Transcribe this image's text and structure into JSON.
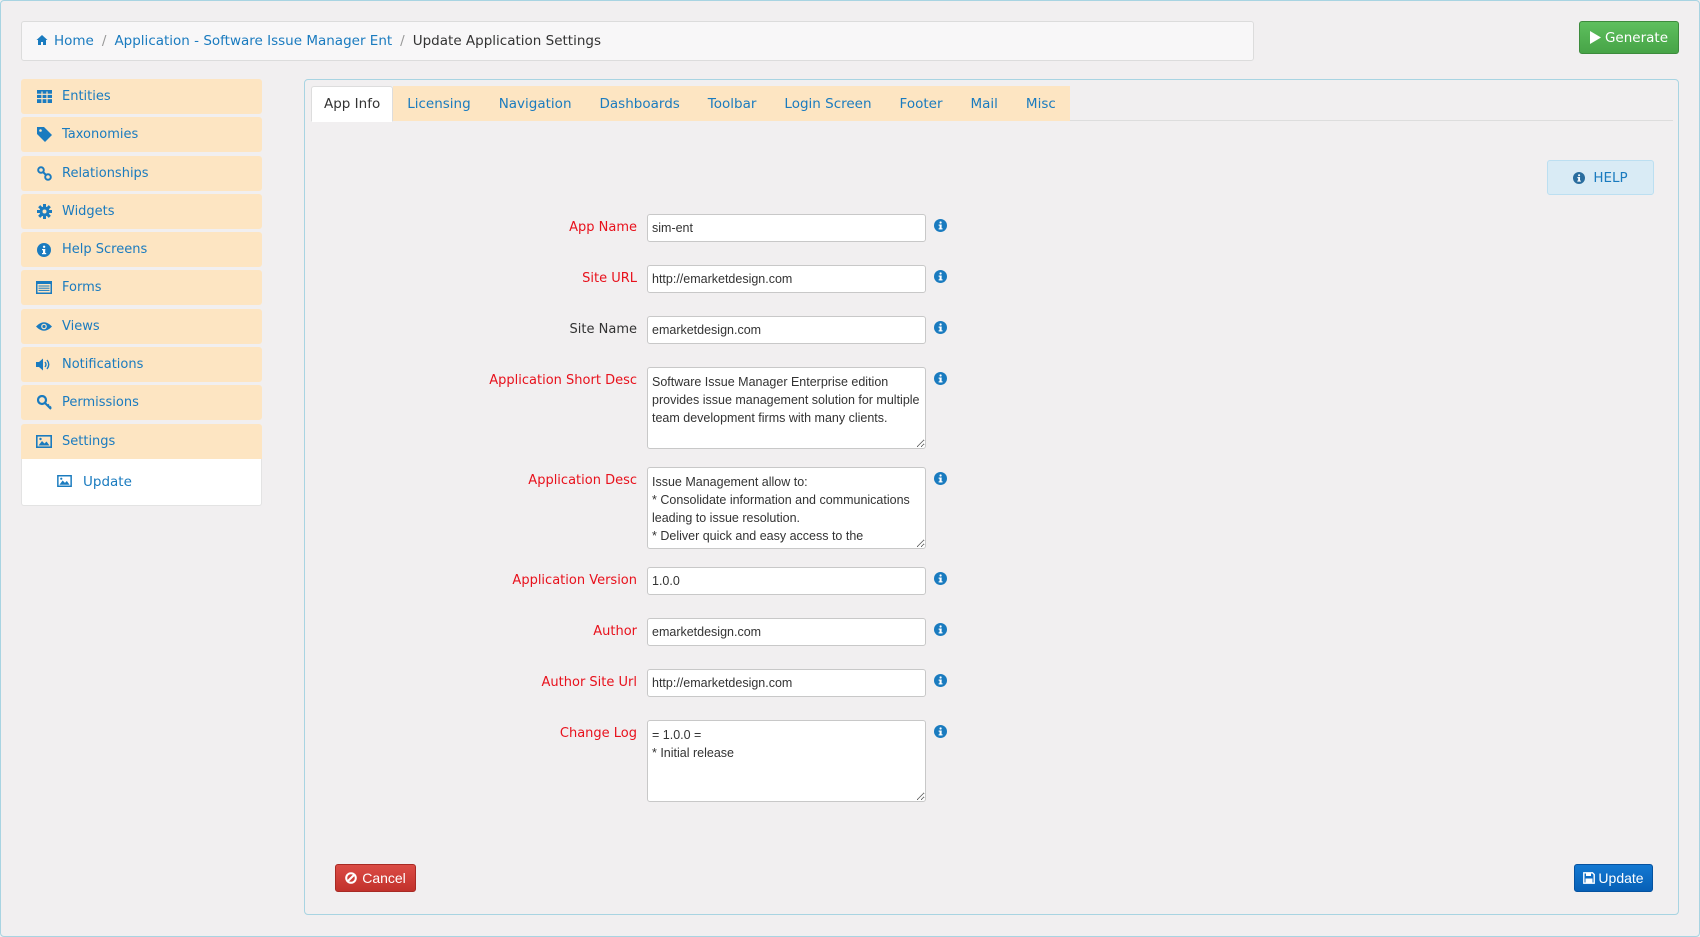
{
  "breadcrumb": {
    "home": "Home",
    "application": "Application - Software Issue Manager Ent",
    "current": "Update Application Settings",
    "separator": "/"
  },
  "toolbar": {
    "generate_label": "Generate"
  },
  "sidebar": {
    "items": [
      {
        "label": "Entities",
        "icon": "table-icon"
      },
      {
        "label": "Taxonomies",
        "icon": "tag-icon"
      },
      {
        "label": "Relationships",
        "icon": "link-icon"
      },
      {
        "label": "Widgets",
        "icon": "gear-icon"
      },
      {
        "label": "Help Screens",
        "icon": "info-icon"
      },
      {
        "label": "Forms",
        "icon": "list-alt-icon"
      },
      {
        "label": "Views",
        "icon": "eye-icon"
      },
      {
        "label": "Notifications",
        "icon": "volume-icon"
      },
      {
        "label": "Permissions",
        "icon": "key-icon"
      },
      {
        "label": "Settings",
        "icon": "picture-icon"
      }
    ],
    "sub_item": {
      "label": "Update",
      "icon": "picture-icon"
    }
  },
  "tabs": [
    {
      "label": "App Info",
      "active": true
    },
    {
      "label": "Licensing"
    },
    {
      "label": "Navigation"
    },
    {
      "label": "Dashboards"
    },
    {
      "label": "Toolbar"
    },
    {
      "label": "Login Screen"
    },
    {
      "label": "Footer"
    },
    {
      "label": "Mail"
    },
    {
      "label": "Misc"
    }
  ],
  "help_label": "HELP",
  "form": {
    "app_name": {
      "label": "App Name",
      "value": "sim-ent",
      "required": true
    },
    "site_url": {
      "label": "Site URL",
      "value": "http://emarketdesign.com",
      "required": true
    },
    "site_name": {
      "label": "Site Name",
      "value": "emarketdesign.com",
      "required": false
    },
    "short_desc": {
      "label": "Application Short Desc",
      "value": "Software Issue Manager Enterprise edition provides issue management solution for multiple team development firms with many clients.",
      "required": true
    },
    "app_desc": {
      "label": "Application Desc",
      "value": "Issue Management allow to:\n* Consolidate information and communications leading to issue resolution.\n* Deliver quick and easy access to the",
      "required": true
    },
    "app_version": {
      "label": "Application Version",
      "value": "1.0.0",
      "required": true
    },
    "author": {
      "label": "Author",
      "value": "emarketdesign.com",
      "required": true
    },
    "author_url": {
      "label": "Author Site Url",
      "value": "http://emarketdesign.com",
      "required": true
    },
    "change_log": {
      "label": "Change Log",
      "value": "= 1.0.0 =\n* Initial release",
      "required": true
    }
  },
  "actions": {
    "cancel_label": "Cancel",
    "update_label": "Update"
  },
  "colors": {
    "link": "#1a7bbf",
    "required_label": "#e8111c",
    "sidebar_bg": "#fde5c2",
    "generate": "#47a447",
    "cancel": "#c2322c",
    "update": "#0760b6"
  }
}
